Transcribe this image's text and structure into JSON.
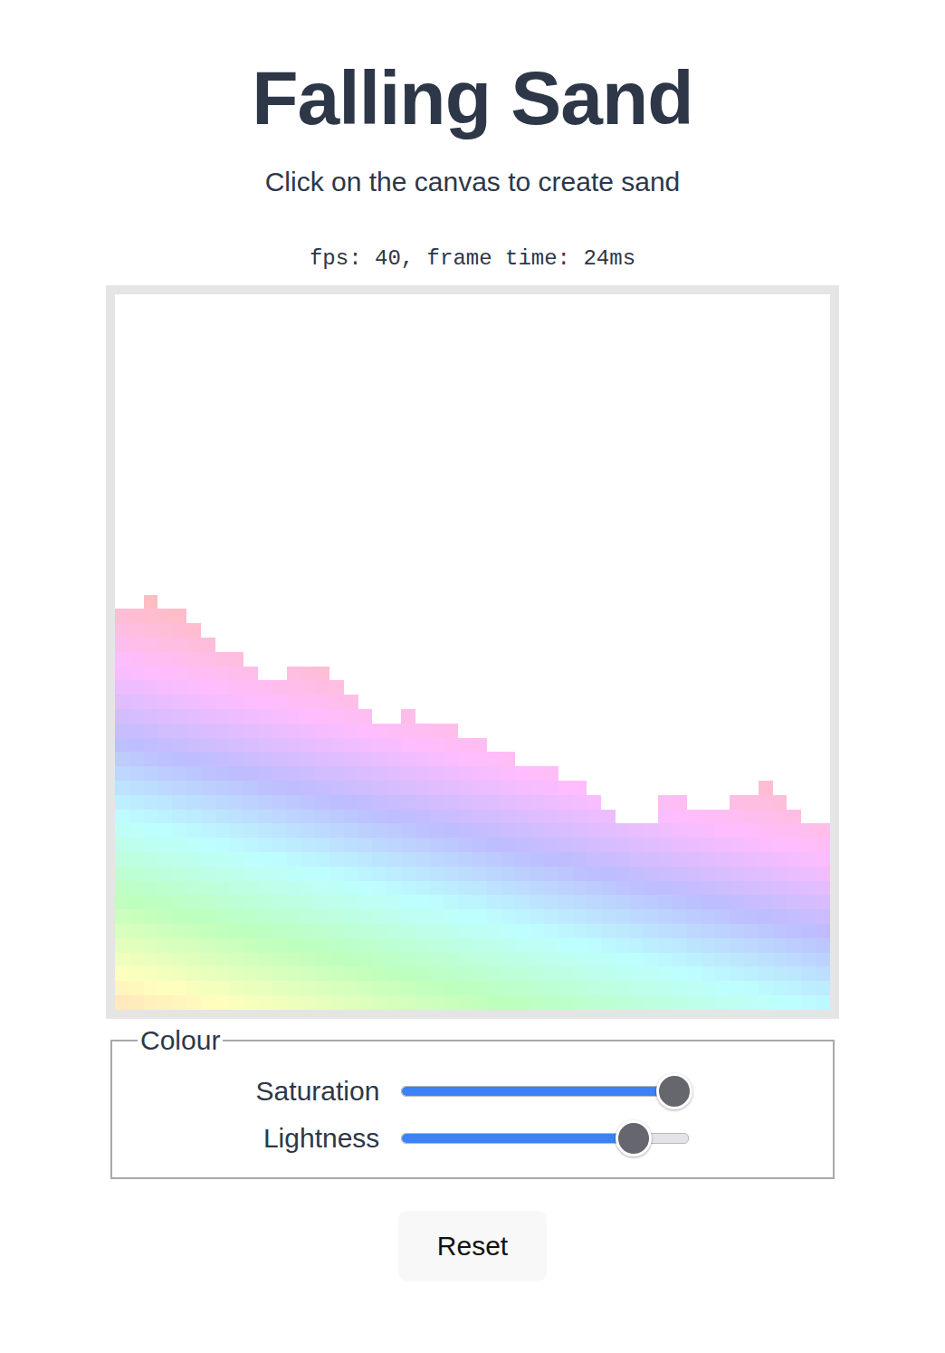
{
  "title": "Falling Sand",
  "subtitle": "Click on the canvas to create sand",
  "stats": "fps: 40, frame time: 24ms",
  "sand": {
    "columns": [
      28,
      28,
      29,
      28,
      28,
      27,
      26,
      25,
      25,
      24,
      23,
      23,
      24,
      24,
      24,
      23,
      22,
      21,
      20,
      20,
      21,
      20,
      20,
      20,
      19,
      19,
      18,
      18,
      17,
      17,
      17,
      16,
      16,
      15,
      14,
      13,
      13,
      13,
      15,
      15,
      14,
      14,
      14,
      15,
      15,
      16,
      15,
      14,
      13,
      13
    ]
  },
  "colour": {
    "legend": "Colour",
    "sliders": [
      {
        "label": "Saturation",
        "level": 1.0
      },
      {
        "label": "Lightness",
        "level": 0.85
      }
    ]
  },
  "buttons": [
    "Reset"
  ]
}
